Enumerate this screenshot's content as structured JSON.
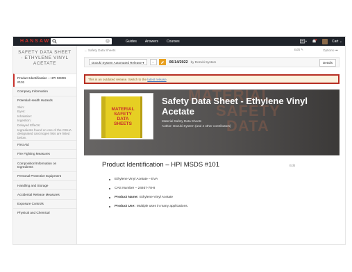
{
  "topbar": {
    "logo": "HANSAW",
    "search_placeholder": "",
    "nav": [
      "Guides",
      "Answers",
      "Courses"
    ],
    "cart_label": "Cart"
  },
  "sidebar": {
    "title": "SAFETY DATA SHEET - ETHYLENE VINYL ACETATE",
    "items": [
      {
        "label": "Product Identification – HPI MSDS #101",
        "active": true
      },
      {
        "label": "Company Information"
      },
      {
        "label": "Potential Health Hazards"
      },
      {
        "label": "Skin:",
        "sub": true
      },
      {
        "label": "Eyes:",
        "sub": true
      },
      {
        "label": "Inhalation:",
        "sub": true
      },
      {
        "label": "Ingestion:",
        "sub": true
      },
      {
        "label": "Delayed Effects:",
        "sub": true
      },
      {
        "label": "Ingredients found on one of the OSHA designated carcinogen lists are listed below.",
        "sub": true
      },
      {
        "label": "First Aid"
      },
      {
        "label": "Fire Fighting Measures"
      },
      {
        "label": "Composition/Information on Ingredients"
      },
      {
        "label": "Personal Protective Equipment"
      },
      {
        "label": "Handling and Storage"
      },
      {
        "label": "Accidental Release Measures"
      },
      {
        "label": "Exposure Controls"
      },
      {
        "label": "Physical and Chemical"
      }
    ]
  },
  "main": {
    "breadcrumb": "Safety Data Sheets",
    "edit_label": "Edit",
    "options_label": "Options",
    "release": {
      "select": "Dozuki System Automated Release",
      "date": "06/14/2022",
      "by": "by Dozuki System",
      "details_label": "Details"
    },
    "alert": {
      "text": "This is an outdated release. Switch to the",
      "link": "latest release",
      "after": "."
    },
    "hero": {
      "title": "Safety Data Sheet - Ethylene Vinyl Acetate",
      "subtitle": "Material Safety Data Sheets",
      "author": "Author: Dozuki System (and 4 other contributors)",
      "binder_lines": [
        "MATERIAL",
        "SAFETY",
        "DATA",
        "SHEETS"
      ],
      "bg_words": [
        "MATERIAL",
        "SAFETY",
        "DATA"
      ]
    },
    "section": {
      "title": "Product Identification – HPI MSDS #101",
      "edit_label": "Edit",
      "bullets": [
        {
          "label": "",
          "text": "Ethylene Vinyl Acetate – EVA"
        },
        {
          "label": "",
          "text": "CAS Number – 24937-78-8"
        },
        {
          "label": "Product Name:",
          "text": "Ethylene-Vinyl Acetate"
        },
        {
          "label": "Product Use:",
          "text": "Multiple uses in many applications."
        }
      ]
    }
  },
  "colors": {
    "accent": "#c8302b",
    "topbar": "#1f232a",
    "alert_border": "#b72d22",
    "alert_bg": "#fbf1de",
    "binder_yellow": "#e8d12a"
  }
}
